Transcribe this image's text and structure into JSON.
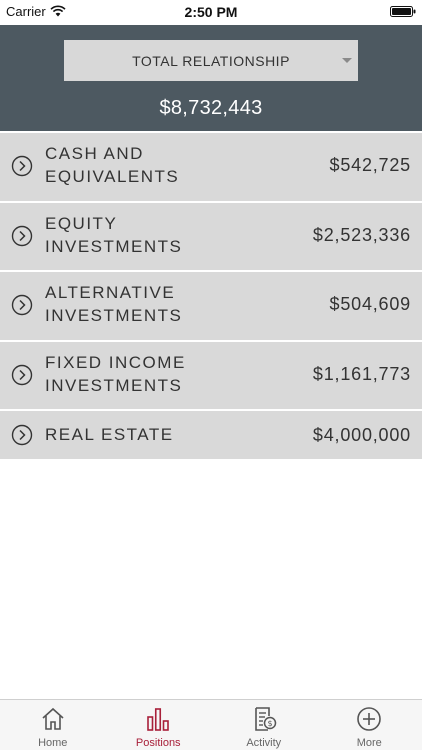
{
  "status_bar": {
    "carrier": "Carrier",
    "time": "2:50 PM"
  },
  "header": {
    "selector_label": "TOTAL RELATIONSHIP",
    "total": "$8,732,443"
  },
  "positions": [
    {
      "line1": "CASH AND",
      "line2": "EQUIVALENTS",
      "value": "$542,725"
    },
    {
      "line1": "EQUITY",
      "line2": "INVESTMENTS",
      "value": "$2,523,336"
    },
    {
      "line1": "ALTERNATIVE",
      "line2": "INVESTMENTS",
      "value": "$504,609"
    },
    {
      "line1": "FIXED INCOME",
      "line2": "INVESTMENTS",
      "value": "$1,161,773"
    },
    {
      "line1": "REAL ESTATE",
      "line2": "",
      "value": "$4,000,000"
    }
  ],
  "tabs": [
    {
      "label": "Home",
      "icon": "home-icon"
    },
    {
      "label": "Positions",
      "icon": "bar-chart-icon",
      "active": true
    },
    {
      "label": "Activity",
      "icon": "document-dollar-icon"
    },
    {
      "label": "More",
      "icon": "plus-circle-icon"
    }
  ],
  "colors": {
    "header_bg": "#4d5961",
    "row_bg": "#d9d9d9",
    "accent": "#a8203a"
  }
}
